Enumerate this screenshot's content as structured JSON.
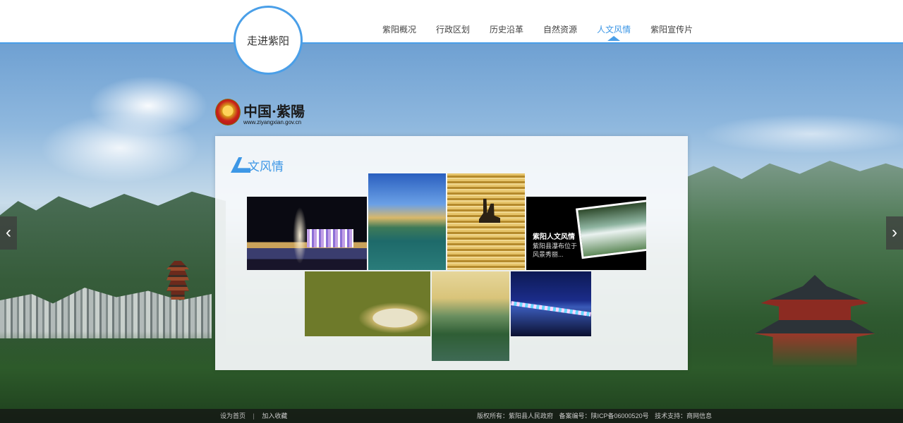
{
  "header": {
    "logo_text": "走进紫阳",
    "nav": [
      {
        "label": "紫阳概况"
      },
      {
        "label": "行政区划"
      },
      {
        "label": "历史沿革"
      },
      {
        "label": "自然资源"
      },
      {
        "label": "人文风情",
        "active": true
      },
      {
        "label": "紫阳宣传片"
      }
    ],
    "accent_color": "#4a9fe8"
  },
  "brand": {
    "title": "中国·紫陽",
    "url": "www.ziyangxian.gov.cn"
  },
  "panel": {
    "title": "文风情",
    "feature": {
      "title": "紫阳人文风情",
      "desc": "紫阳县瀑布位于风景秀丽..."
    }
  },
  "nav_arrows": {
    "left": "‹",
    "right": "›"
  },
  "footer": {
    "home": "设为首页",
    "favorite": "加入收藏",
    "separator": "|",
    "copyright": "版权所有：紫阳县人民政府",
    "icp": "备案编号：陕ICP备06000520号",
    "support": "技术支持：商网信息"
  }
}
